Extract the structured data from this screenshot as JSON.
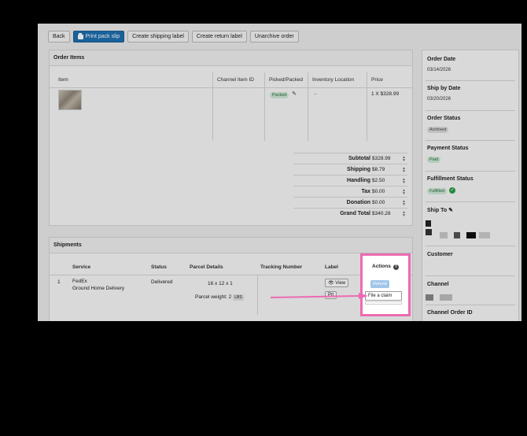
{
  "toolbar": {
    "back": "Back",
    "print_pack_slip": "Print pack slip",
    "create_shipping_label": "Create shipping label",
    "create_return_label": "Create return label",
    "unarchive_order": "Unarchive order"
  },
  "order_items": {
    "title": "Order Items",
    "columns": [
      "Item",
      "Channel Item ID",
      "Picked/Packed",
      "Inventory Location",
      "Price"
    ],
    "row": {
      "status": "Packed",
      "location": "--",
      "price": "1 X $328.99"
    }
  },
  "totals": [
    {
      "label": "Subtotal",
      "value": "$328.99"
    },
    {
      "label": "Shipping",
      "value": "$8.79"
    },
    {
      "label": "Handling",
      "value": "$2.50"
    },
    {
      "label": "Tax",
      "value": "$0.00"
    },
    {
      "label": "Donation",
      "value": "$0.00"
    },
    {
      "label": "Grand Total",
      "value": "$340.28"
    }
  ],
  "shipments": {
    "title": "Shipments",
    "columns": [
      "Service",
      "Status",
      "Parcel Details",
      "Tracking Number",
      "Label",
      "Actions"
    ],
    "row": {
      "index": "1",
      "carrier": "FedEx",
      "service": "Ground Home Delivery",
      "status": "Delivered",
      "dimensions": "16 x 12 x 1",
      "weight": "Parcel weight: 2",
      "unit": "LBS",
      "view": "View",
      "print_partial": "Pri"
    },
    "actions": {
      "refund": "Refund",
      "file_claim": "File a claim"
    }
  },
  "sidebar": {
    "order_date_label": "Order Date",
    "order_date": "03/14/2026",
    "ship_by_label": "Ship by Date",
    "ship_by": "03/20/2026",
    "order_status_label": "Order Status",
    "order_status": "Archived",
    "payment_status_label": "Payment Status",
    "payment_status": "Paid",
    "fulfillment_status_label": "Fulfillment Status",
    "fulfillment_status": "Fulfilled",
    "ship_to_label": "Ship To",
    "customer_label": "Customer",
    "channel_label": "Channel",
    "channel_order_id_label": "Channel Order ID"
  },
  "colors": {
    "accent": "#1e6fb0",
    "highlight": "#ec6bb1",
    "success": "#2b9c48"
  }
}
